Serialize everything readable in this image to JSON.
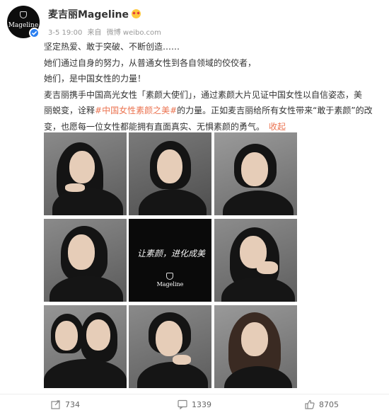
{
  "author": {
    "name": "麦吉丽Mageline",
    "avatar_text": "Mageline",
    "verified_icon": "verified-badge-icon",
    "emoji_icon": "angry-face-emoji"
  },
  "meta": {
    "time": "3-5 19:00",
    "source_prefix": "来自",
    "source": "微博 weibo.com"
  },
  "post": {
    "line1": "坚定热爱、敢于突破、不断创造……",
    "line2": "她们通过自身的努力，从普通女性到各自领域的佼佼者，",
    "line3": "她们，是中国女性的力量！",
    "line4": "麦吉丽携手中国高光女性「素颜大使们」，通过素颜大片见证中国女性以自信姿态，美",
    "line5_a": "丽蜕变，诠释",
    "line5_tag": "#中国女性素颜之美#",
    "line5_b": "的力量。正如麦吉丽给所有女性带来“敢于素颜”的改",
    "line6": "变，也愿每一位女性都能拥有直面真实、无惧素颜的勇气。",
    "fold_label": "收起"
  },
  "center_image": {
    "calligraphy": "让素颜，进化成美",
    "logo": "Mageline"
  },
  "actions": {
    "share_count": "734",
    "comment_count": "1339",
    "like_count": "8705"
  },
  "colors": {
    "accent": "#eb7350",
    "verified": "#2b7ff0",
    "text": "#333333",
    "muted": "#999999"
  }
}
